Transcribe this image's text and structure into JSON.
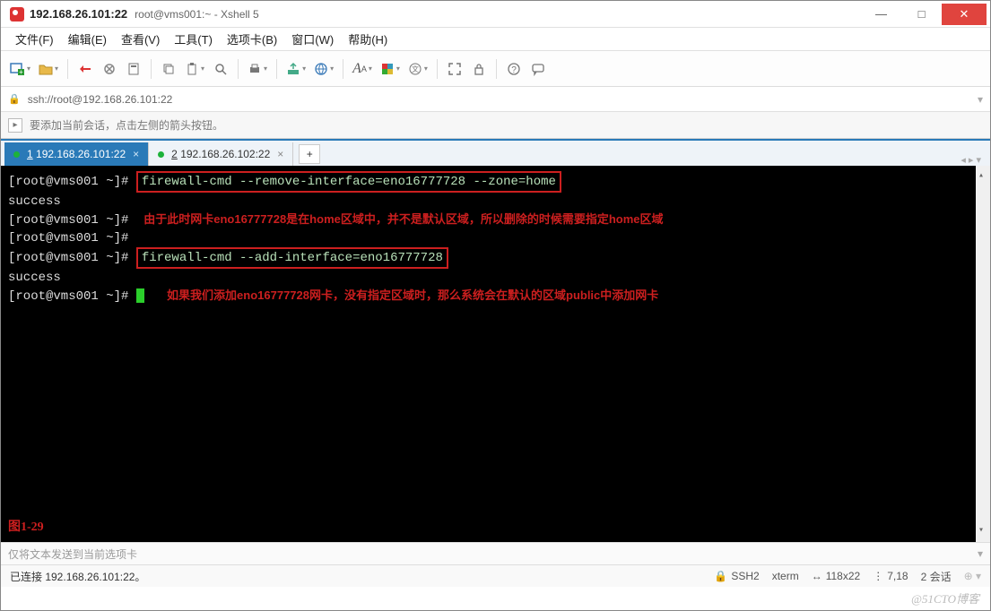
{
  "window": {
    "ip_title": "192.168.26.101:22",
    "sub_title": "root@vms001:~ - Xshell 5",
    "minimize": "—",
    "maximize": "□",
    "close": "✕"
  },
  "menu": {
    "file": "文件(F)",
    "edit": "编辑(E)",
    "view": "查看(V)",
    "tools": "工具(T)",
    "tabs_menu": "选项卡(B)",
    "window_menu": "窗口(W)",
    "help": "帮助(H)"
  },
  "toolbar_icons": {
    "new": "new-session-icon",
    "open": "open-icon",
    "connect": "connect-icon",
    "disconnect": "disconnect-icon",
    "props": "server-props-icon",
    "copy": "copy-icon",
    "paste": "paste-icon",
    "search": "search-icon",
    "print": "print-icon",
    "fileman": "ftp-icon",
    "globe": "browser-icon",
    "font": "font-icon",
    "color": "color-scheme-icon",
    "encode": "encoding-icon",
    "fullscreen": "fullscreen-icon",
    "lock": "lock-icon",
    "help": "help-icon",
    "bubble": "feedback-icon"
  },
  "address": {
    "url": "ssh://root@192.168.26.101:22"
  },
  "hint": {
    "text": "要添加当前会话，点击左侧的箭头按钮。"
  },
  "tabs": {
    "active": {
      "index": "1",
      "label": "192.168.26.101:22"
    },
    "inactive": {
      "index": "2",
      "label": "192.168.26.102:22"
    },
    "add": "+"
  },
  "terminal": {
    "lines": [
      {
        "prompt": "[root@vms001 ~]#",
        "cmd_boxed": "firewall-cmd --remove-interface=eno16777728 --zone=home"
      },
      {
        "plain": "success"
      },
      {
        "prompt": "[root@vms001 ~]#",
        "comment": "由于此时网卡eno16777728是在home区域中，并不是默认区域，所以删除的时候需要指定home区域"
      },
      {
        "prompt": "[root@vms001 ~]#"
      },
      {
        "prompt": "[root@vms001 ~]#",
        "cmd_boxed": "firewall-cmd --add-interface=eno16777728"
      },
      {
        "plain": "success"
      },
      {
        "prompt": "[root@vms001 ~]#",
        "comment_after_cursor": "如果我们添加eno16777728网卡，没有指定区域时，那么系统会在默认的区域public中添加网卡",
        "cursor": true
      }
    ],
    "figure_label": "图1-29"
  },
  "sendbar": {
    "placeholder": "仅将文本发送到当前选项卡"
  },
  "status": {
    "conn": "已连接 192.168.26.101:22。",
    "ssh": "SSH2",
    "term_type": "xterm",
    "size": "118x22",
    "pos": "7,18",
    "sessions": "2 会话"
  },
  "watermark": "@51CTO博客"
}
